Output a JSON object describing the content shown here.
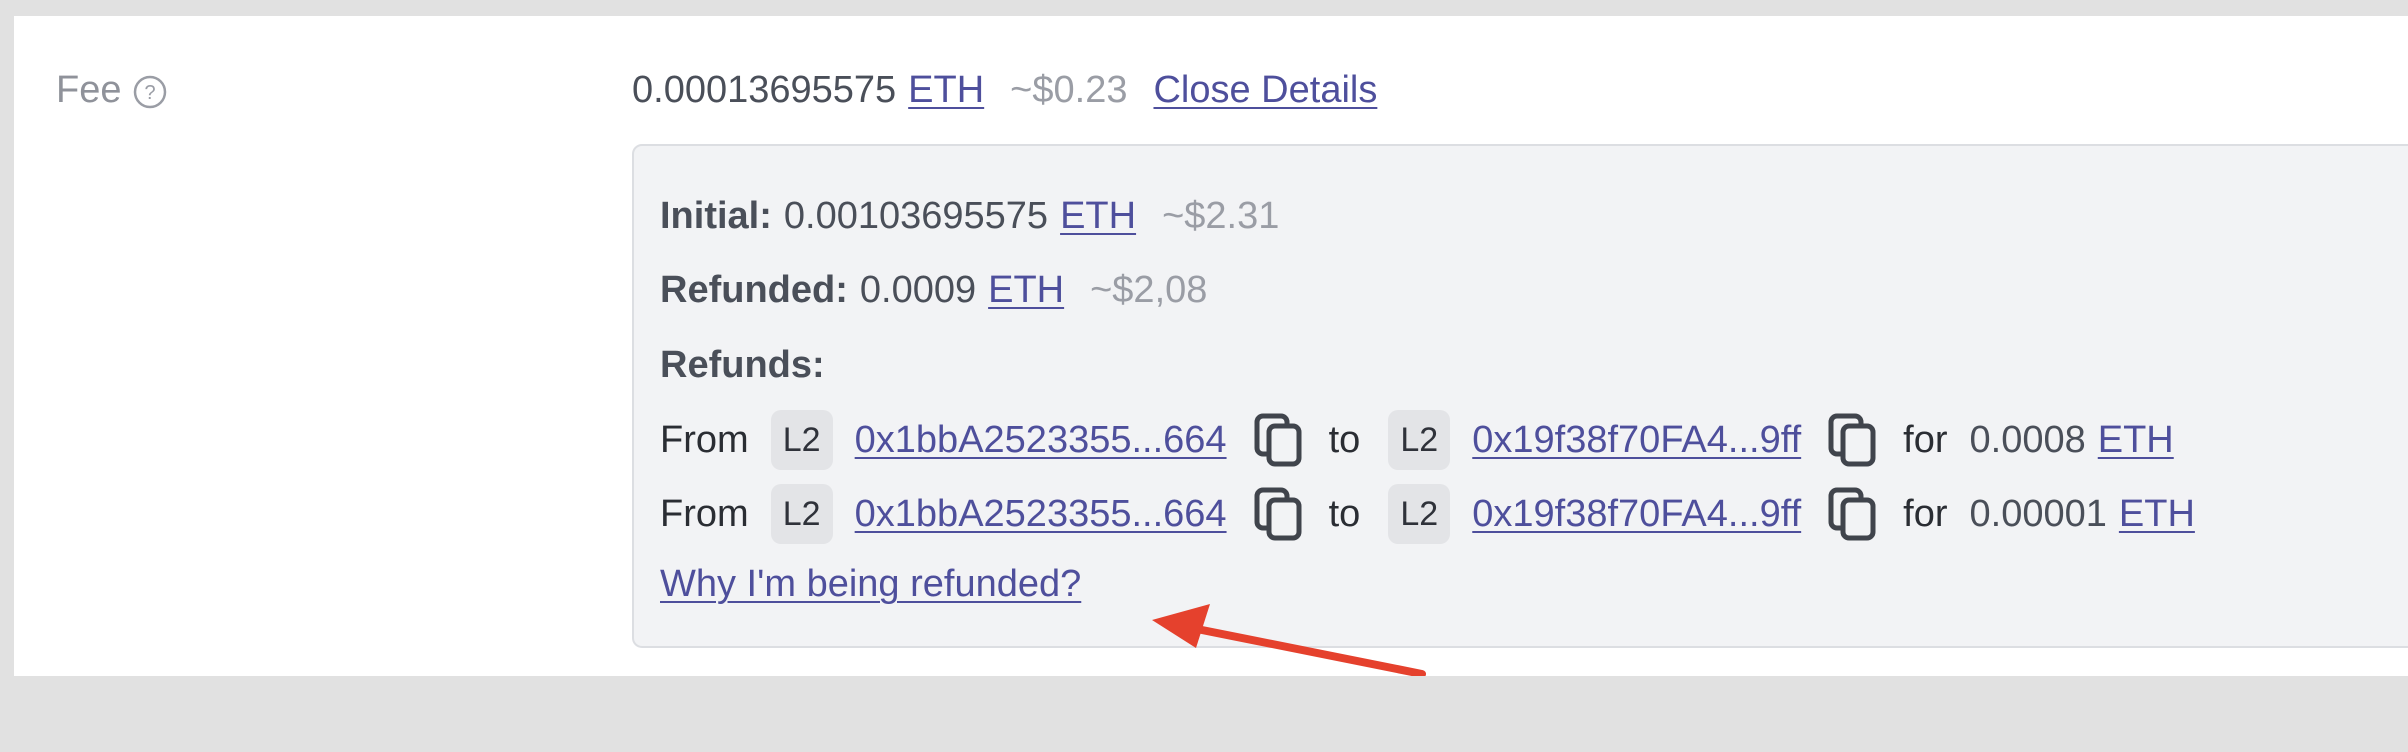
{
  "fee": {
    "label": "Fee",
    "amount": "0.00013695575",
    "currency": "ETH",
    "usd": "~$0.23",
    "toggle_label": "Close Details"
  },
  "details": {
    "initial_label": "Initial:",
    "initial_amount": "0.00103695575",
    "initial_currency": "ETH",
    "initial_usd": "~$2.31",
    "refunded_label": "Refunded:",
    "refunded_amount": "0.0009",
    "refunded_currency": "ETH",
    "refunded_usd": "~$2,08",
    "refunds_label": "Refunds:",
    "refunds": [
      {
        "from_word": "From",
        "from_network": "L2",
        "from_address": "0x1bbA2523355...664",
        "to_word": "to",
        "to_network": "L2",
        "to_address": "0x19f38f70FA4...9ff",
        "for_word": "for",
        "amount": "0.0008",
        "currency": "ETH"
      },
      {
        "from_word": "From",
        "from_network": "L2",
        "from_address": "0x1bbA2523355...664",
        "to_word": "to",
        "to_network": "L2",
        "to_address": "0x19f38f70FA4...9ff",
        "for_word": "for",
        "amount": "0.00001",
        "currency": "ETH"
      }
    ],
    "why_link": "Why I'm being refunded?"
  },
  "colors": {
    "link": "#4e4f9c",
    "annotation_arrow": "#e5412d"
  },
  "icons": [
    "help-icon",
    "copy-icon",
    "annotation-arrow"
  ]
}
